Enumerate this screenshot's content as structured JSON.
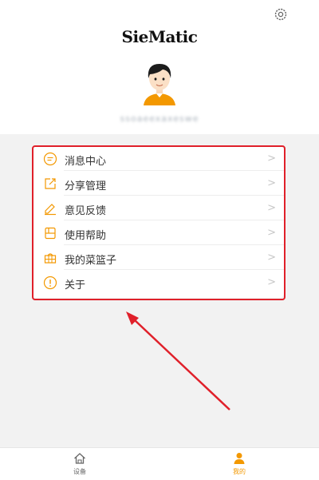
{
  "header": {
    "brand": "SieMatic",
    "account": "ssoaeexaxeswe"
  },
  "menu": {
    "items": [
      {
        "label": "消息中心",
        "icon": "message-icon"
      },
      {
        "label": "分享管理",
        "icon": "share-icon"
      },
      {
        "label": "意见反馈",
        "icon": "feedback-icon"
      },
      {
        "label": "使用帮助",
        "icon": "help-icon"
      },
      {
        "label": "我的菜篮子",
        "icon": "basket-icon"
      },
      {
        "label": "关于",
        "icon": "info-icon"
      }
    ],
    "chevron": ">"
  },
  "tabbar": {
    "home_label": "设备",
    "mine_label": "我的"
  },
  "colors": {
    "accent": "#f39800",
    "annotation": "#e0202a",
    "background": "#f2f2f2"
  }
}
